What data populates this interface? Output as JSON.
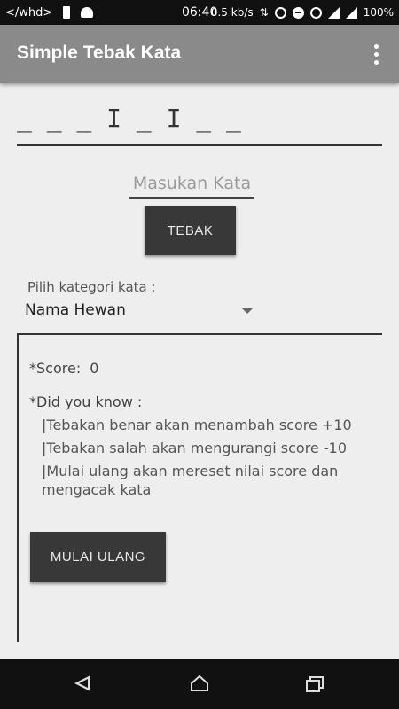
{
  "status_bar": {
    "left_text": "</whd>",
    "time": "06:40",
    "speed": "0.5 kb/s",
    "battery": "100%",
    "icons": [
      "battery-icon",
      "android-icon",
      "data-arrows-icon",
      "hotspot-icon",
      "dnd-icon",
      "alarm-icon",
      "signal-icon",
      "signal-icon"
    ]
  },
  "app_bar": {
    "title": "Simple Tebak Kata",
    "menu_icon": "overflow-menu-icon"
  },
  "game": {
    "word_display": "_ _ _ I _ I _ _",
    "guess_placeholder": "Masukan Kata",
    "guess_value": "",
    "submit_label": "TEBAK"
  },
  "category": {
    "label": "Pilih kategori kata :",
    "selected": "Nama Hewan"
  },
  "info": {
    "score_label": "*Score:",
    "score_value": "0",
    "dyk_title": "*Did you know :",
    "tips": [
      "|Tebakan benar akan menambah score +10",
      "|Tebakan salah akan mengurangi score -10",
      "|Mulai ulang akan mereset nilai score dan mengacak kata"
    ],
    "reset_label": "MULAI ULANG"
  },
  "nav_bar": {
    "icons": [
      "back-icon",
      "home-icon",
      "recent-apps-icon"
    ]
  },
  "colors": {
    "app_bar": "#8a8a8a",
    "status_bar": "#111111",
    "background": "#eeeeee",
    "button": "#383838"
  }
}
